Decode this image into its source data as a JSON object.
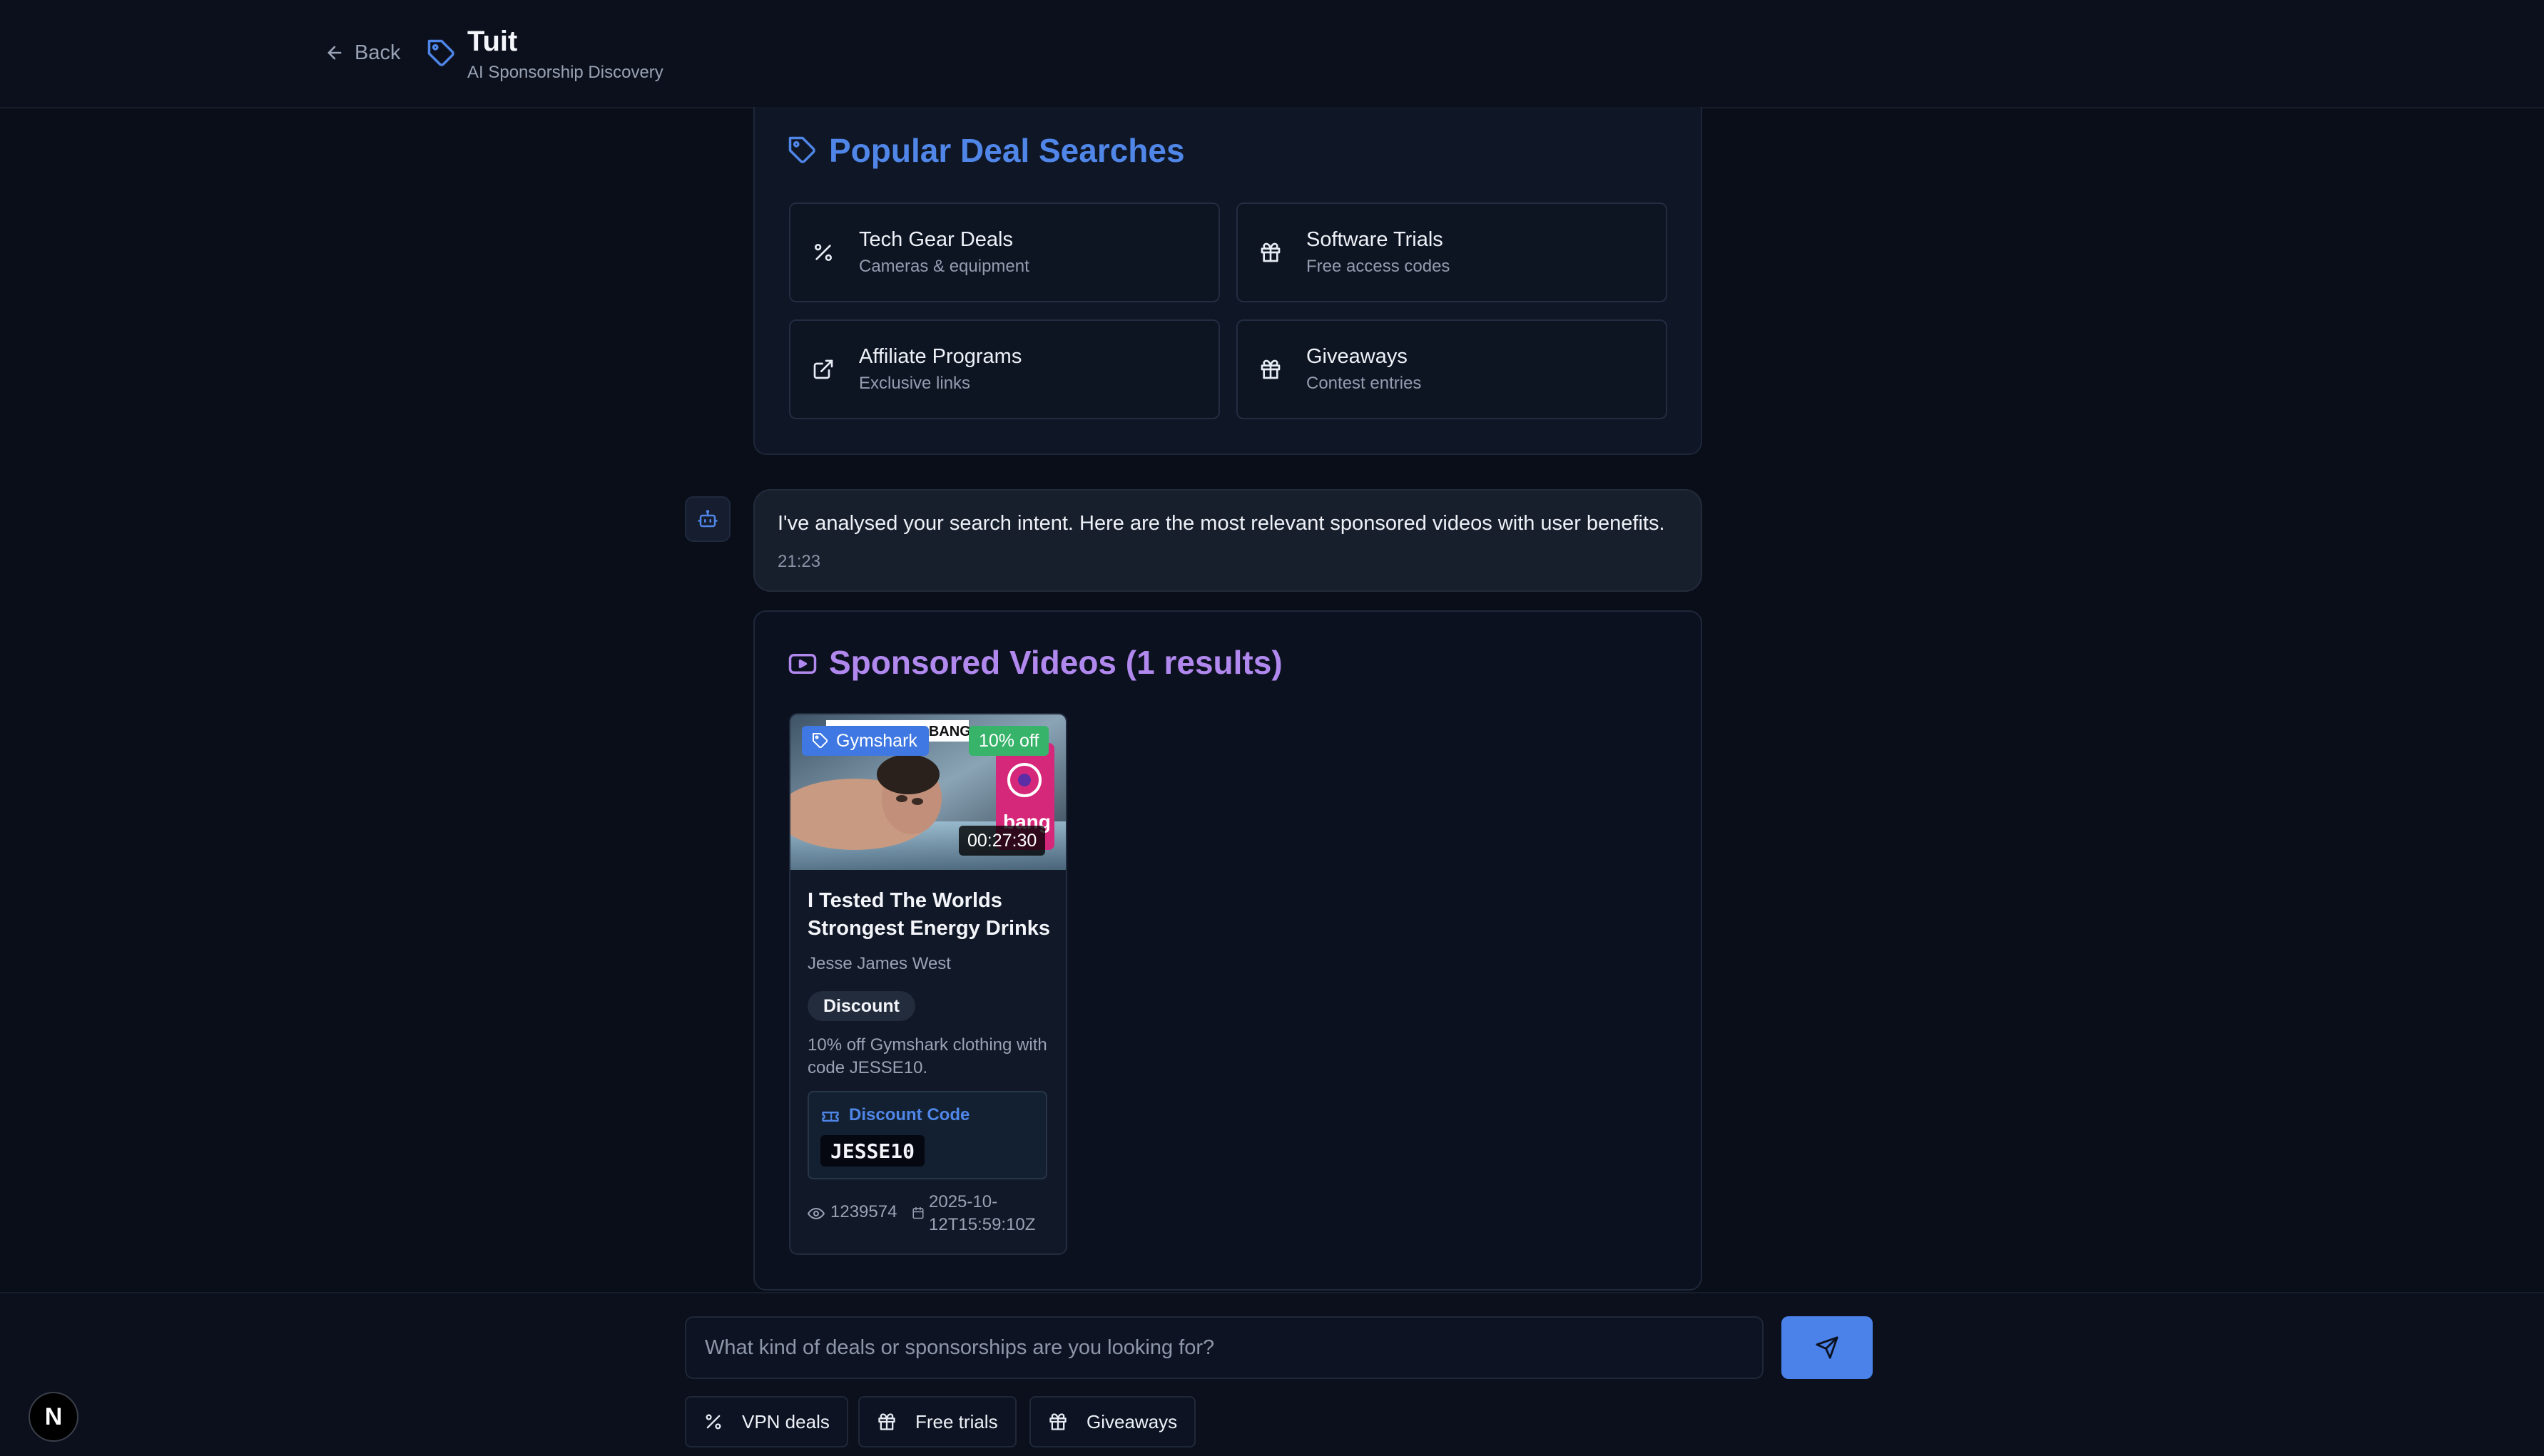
{
  "colors": {
    "background": "#0a0e19",
    "accent_blue": "#4f86e8",
    "accent_purple": "#b088ee",
    "discount_green": "#37b36a",
    "send_button": "#4a82ea"
  },
  "header": {
    "back_label": "Back",
    "back_icon": "arrow-left-icon",
    "brand_icon": "tag-icon",
    "app_title": "Tuit",
    "app_subtitle": "AI Sponsorship Discovery"
  },
  "popular": {
    "title": "Popular Deal Searches",
    "cards": [
      {
        "title": "Tech Gear Deals",
        "subtitle": "Cameras & equipment",
        "icon": "percent-icon"
      },
      {
        "title": "Software Trials",
        "subtitle": "Free access codes",
        "icon": "gift-icon"
      },
      {
        "title": "Affiliate Programs",
        "subtitle": "Exclusive links",
        "icon": "external-link-icon"
      },
      {
        "title": "Giveaways",
        "subtitle": "Contest entries",
        "icon": "gift-icon"
      }
    ]
  },
  "message": {
    "avatar_icon": "bot-icon",
    "text": "I've analysed your search intent. Here are the most relevant sponsored videos with user benefits.",
    "time": "21:23"
  },
  "sponsored": {
    "title": "Sponsored Videos (1 results)",
    "title_icon": "video-icon",
    "videos": [
      {
        "thumbnail_text": "DON'T DRINK BANG!",
        "can_text": "bang",
        "brand": "Gymshark",
        "offer_badge": "10% off",
        "duration": "00:27:30",
        "title": "I Tested The Worlds Strongest Energy Drinks",
        "channel": "Jesse James West",
        "type": "Discount",
        "description": "10% off Gymshark clothing with code JESSE10.",
        "code_label": "Discount Code",
        "code": "JESSE10",
        "views": "1239574",
        "date": "2025-10-12T15:59:10Z"
      }
    ]
  },
  "composer": {
    "placeholder": "What kind of deals or sponsorships are you looking for?",
    "send_icon": "send-icon",
    "chips": [
      {
        "label": "VPN deals",
        "icon": "percent-icon"
      },
      {
        "label": "Free trials",
        "icon": "gift-icon"
      },
      {
        "label": "Giveaways",
        "icon": "gift-icon"
      }
    ]
  },
  "badge": {
    "letter": "N"
  }
}
